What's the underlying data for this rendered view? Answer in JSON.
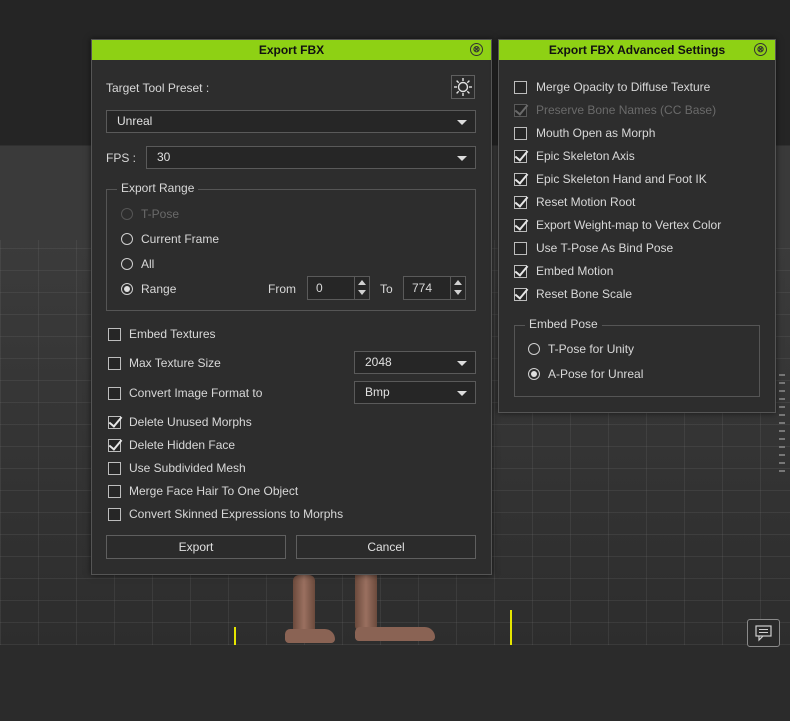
{
  "export_fbx": {
    "title": "Export FBX",
    "close_glyph": "⊗",
    "target_preset_label": "Target Tool Preset :",
    "preset_icon": "gear-icon",
    "preset_value": "Unreal",
    "fps_label": "FPS :",
    "fps_value": "30",
    "export_range": {
      "title": "Export Range",
      "options": [
        "T-Pose",
        "Current Frame",
        "All",
        "Range"
      ],
      "selected": "Range",
      "from_label": "From",
      "from_value": "0",
      "to_label": "To",
      "to_value": "774"
    },
    "embed_textures": "Embed Textures",
    "max_texture_size": "Max Texture Size",
    "max_texture_value": "2048",
    "convert_image": "Convert Image Format to",
    "convert_image_value": "Bmp",
    "delete_unused_morphs": "Delete Unused Morphs",
    "delete_hidden_face": "Delete Hidden Face",
    "use_subdivided_mesh": "Use Subdivided Mesh",
    "merge_face_hair": "Merge Face Hair To One Object",
    "convert_skinned": "Convert Skinned Expressions to Morphs",
    "export_button": "Export",
    "cancel_button": "Cancel"
  },
  "advanced": {
    "title": "Export FBX Advanced Settings",
    "close_glyph": "⊗",
    "items": [
      {
        "label": "Merge Opacity to Diffuse Texture",
        "checked": false,
        "disabled": false
      },
      {
        "label": "Preserve Bone Names (CC Base)",
        "checked": true,
        "disabled": true
      },
      {
        "label": "Mouth Open as Morph",
        "checked": false,
        "disabled": false
      },
      {
        "label": "Epic Skeleton Axis",
        "checked": true,
        "disabled": false
      },
      {
        "label": "Epic Skeleton Hand and Foot IK",
        "checked": true,
        "disabled": false
      },
      {
        "label": "Reset Motion Root",
        "checked": true,
        "disabled": false
      },
      {
        "label": "Export Weight-map to Vertex Color",
        "checked": true,
        "disabled": false
      },
      {
        "label": "Use T-Pose As Bind Pose",
        "checked": false,
        "disabled": false
      },
      {
        "label": "Embed Motion",
        "checked": true,
        "disabled": false
      },
      {
        "label": "Reset Bone Scale",
        "checked": true,
        "disabled": false
      }
    ],
    "embed_pose": {
      "title": "Embed Pose",
      "options": [
        "T-Pose for Unity",
        "A-Pose for Unreal"
      ],
      "selected": "A-Pose for Unreal"
    }
  },
  "viewport": {
    "chat_icon": "comment-icon"
  }
}
